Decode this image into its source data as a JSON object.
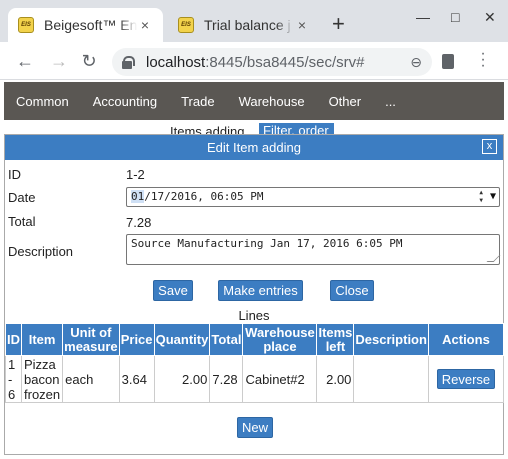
{
  "browser": {
    "tabs": [
      {
        "title": "Beigesoft™ Ent",
        "favicon": "EIS",
        "close": "×"
      },
      {
        "title": "Trial balance j",
        "favicon": "EIS",
        "close": "×"
      }
    ],
    "new_tab": "+",
    "window_controls": {
      "minimize": "—",
      "maximize": "□",
      "close": "✕"
    },
    "nav": {
      "back": "←",
      "forward": "→",
      "reload": "↻"
    },
    "url_host": "localhost",
    "url_rest": ":8445/bsa8445/sec/srv#",
    "zoom_icon": "⊖"
  },
  "app_menu": {
    "items": [
      "Common",
      "Accounting",
      "Trade",
      "Warehouse",
      "Other",
      "..."
    ]
  },
  "background_page": {
    "title": "Items adding",
    "filter_button": "Filter, order"
  },
  "dialog": {
    "title": "Edit Item adding",
    "close_label": "x",
    "fields": {
      "id_label": "ID",
      "id_value": "1-2",
      "date_label": "Date",
      "date_value_selected": "01",
      "date_value_rest": "/17/2016, 06:05 PM",
      "total_label": "Total",
      "total_value": "7.28",
      "description_label": "Description",
      "description_value": "Source Manufacturing Jan 17, 2016 6:05 PM"
    },
    "buttons": {
      "save": "Save",
      "make_entries": "Make entries",
      "close": "Close",
      "new": "New"
    },
    "lines": {
      "title": "Lines",
      "columns": [
        "ID",
        "Item",
        "Unit of measure",
        "Price",
        "Quantity",
        "Total",
        "Warehouse place",
        "Items left",
        "Description",
        "Actions"
      ],
      "rows": [
        {
          "id": "1-6",
          "item": "Pizza bacon frozen",
          "unit": "each",
          "price": "3.64",
          "quantity": "2.00",
          "total": "7.28",
          "place": "Cabinet#2",
          "items_left": "2.00",
          "description": "",
          "action": "Reverse"
        }
      ]
    }
  },
  "colors": {
    "accent": "#3c7dc2",
    "menu_bar": "#5a5753",
    "tab_strip": "#dee1e6"
  }
}
